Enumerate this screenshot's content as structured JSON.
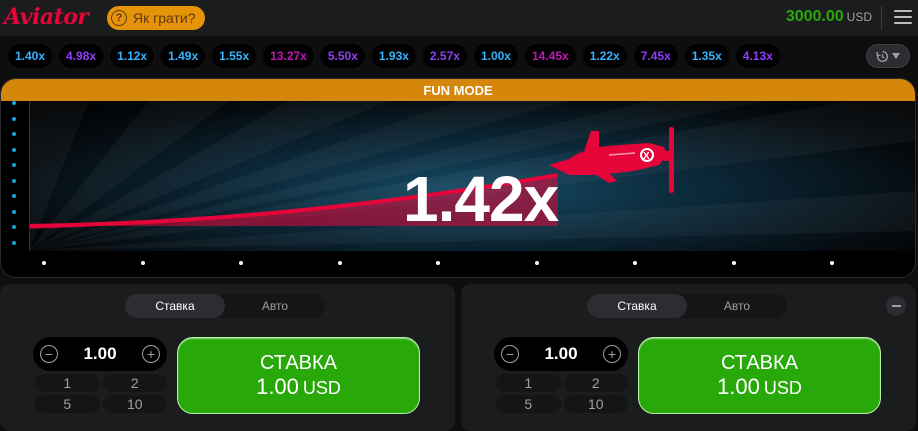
{
  "header": {
    "logo": "Aviator",
    "how_to_play": "Як грати?",
    "balance": "3000.00",
    "currency": "USD"
  },
  "history": [
    {
      "value": "1.40x",
      "color": "#34b4ff"
    },
    {
      "value": "4.98x",
      "color": "#913ef8"
    },
    {
      "value": "1.12x",
      "color": "#34b4ff"
    },
    {
      "value": "1.49x",
      "color": "#34b4ff"
    },
    {
      "value": "1.55x",
      "color": "#34b4ff"
    },
    {
      "value": "13.27x",
      "color": "#c017b4"
    },
    {
      "value": "5.50x",
      "color": "#913ef8"
    },
    {
      "value": "1.93x",
      "color": "#34b4ff"
    },
    {
      "value": "2.57x",
      "color": "#913ef8"
    },
    {
      "value": "1.00x",
      "color": "#34b4ff"
    },
    {
      "value": "14.45x",
      "color": "#c017b4"
    },
    {
      "value": "1.22x",
      "color": "#34b4ff"
    },
    {
      "value": "7.45x",
      "color": "#913ef8"
    },
    {
      "value": "1.35x",
      "color": "#34b4ff"
    },
    {
      "value": "4.13x",
      "color": "#913ef8"
    }
  ],
  "game": {
    "banner": "FUN MODE",
    "multiplier": "1.42x",
    "multiplier_value": 1.42
  },
  "bet_panels": [
    {
      "tabs": [
        "Ставка",
        "Авто"
      ],
      "active_tab": 0,
      "amount": "1.00",
      "quick_amounts": [
        "1",
        "2",
        "5",
        "10"
      ],
      "button_label": "СТАВКА",
      "button_amount": "1.00",
      "button_currency": "USD"
    },
    {
      "tabs": [
        "Ставка",
        "Авто"
      ],
      "active_tab": 0,
      "amount": "1.00",
      "quick_amounts": [
        "1",
        "2",
        "5",
        "10"
      ],
      "button_label": "СТАВКА",
      "button_amount": "1.00",
      "button_currency": "USD"
    }
  ],
  "colors": {
    "accent_red": "#e50539",
    "bet_green": "#28a909",
    "banner_orange": "#d4870a",
    "low_multiplier": "#34b4ff",
    "mid_multiplier": "#913ef8",
    "high_multiplier": "#c017b4"
  }
}
